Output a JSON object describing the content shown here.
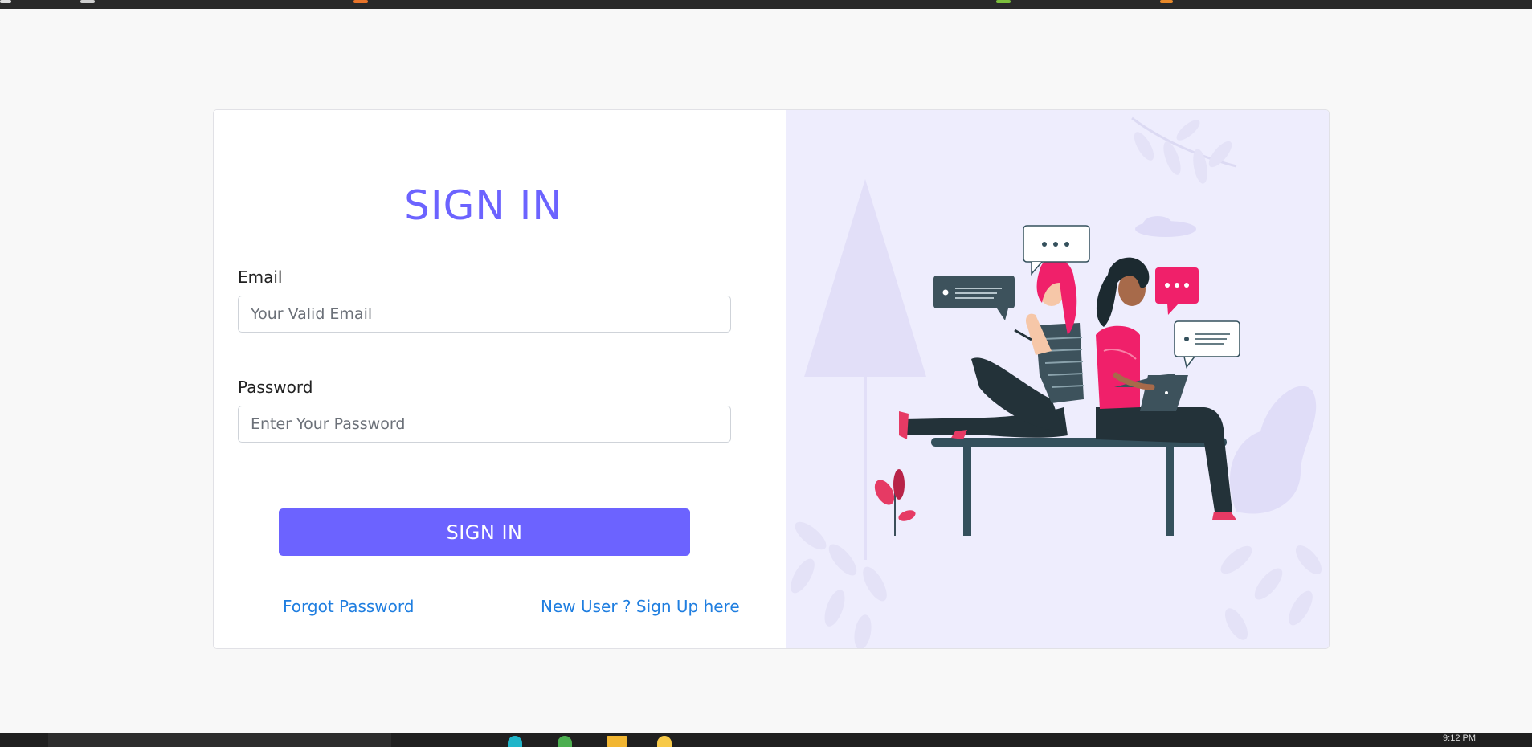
{
  "form": {
    "title": "SIGN IN",
    "email_label": "Email",
    "email_placeholder": "Your Valid Email",
    "password_label": "Password",
    "password_placeholder": "Enter Your Password",
    "submit_label": "SIGN IN",
    "forgot_link": "Forgot Password",
    "signup_link": "New User ? Sign Up here"
  },
  "illustration": {
    "subject": "two-women-sitting-on-bench-chatting-illustration"
  },
  "taskbar": {
    "clock": "9:12 PM"
  },
  "colors": {
    "accent": "#6c63ff",
    "link": "#1f7ee0",
    "art_background": "#eeedfd",
    "pink": "#f0206a",
    "dark": "#2f4450"
  }
}
